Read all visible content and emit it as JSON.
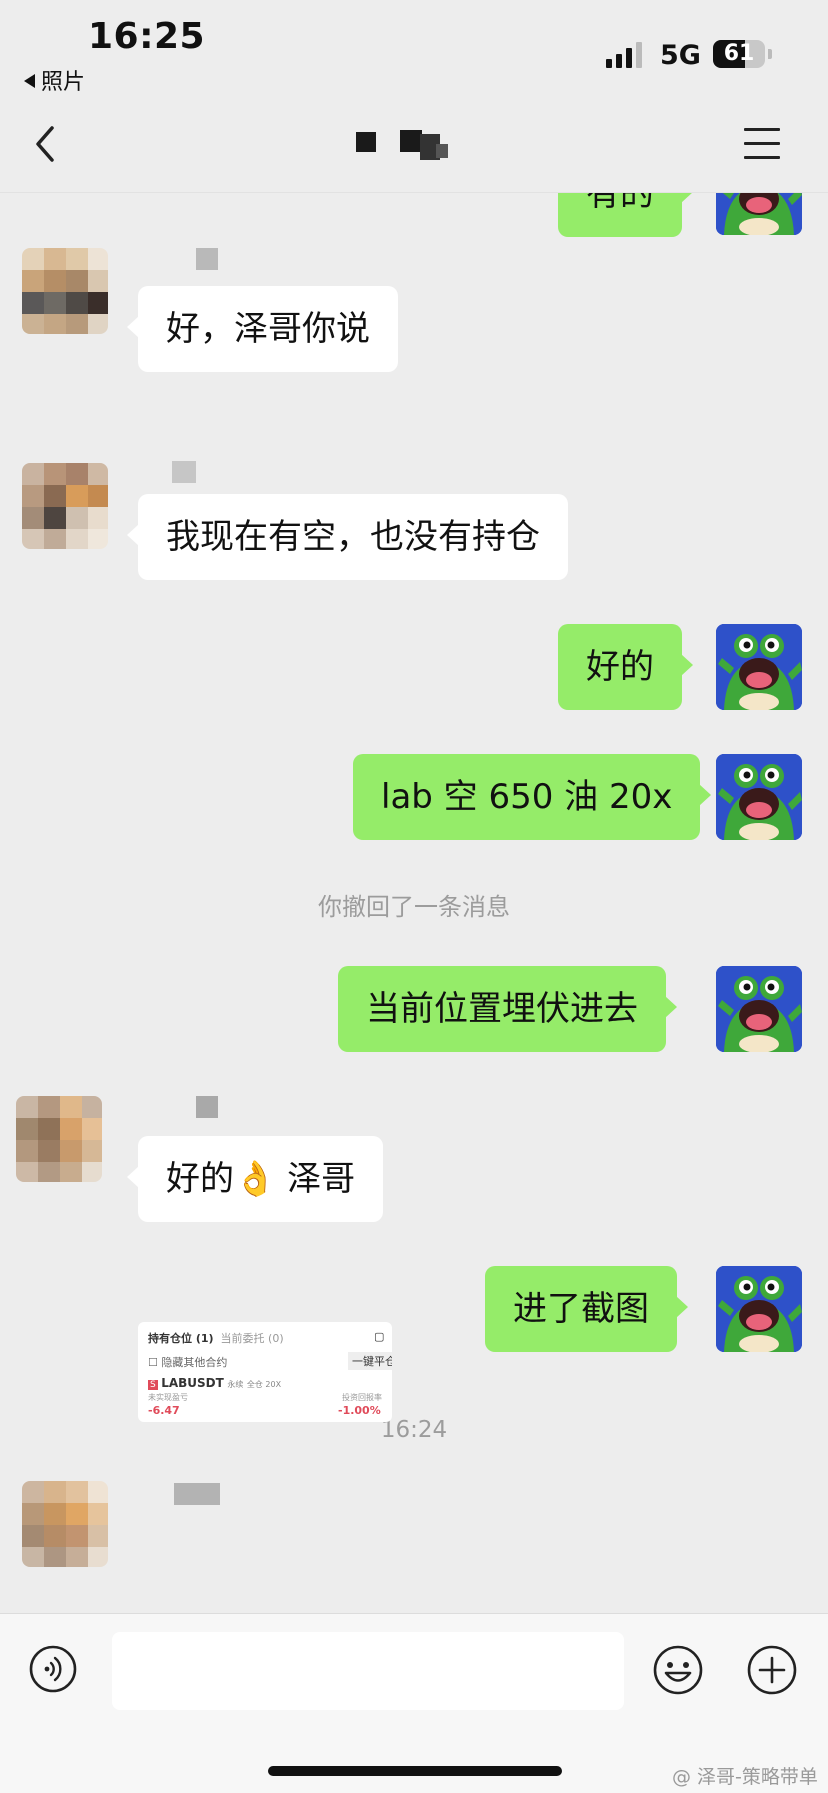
{
  "status_bar": {
    "time": "16:25",
    "back_app": "照片",
    "network": "5G",
    "battery_percent": "61"
  },
  "nav": {
    "icons": {
      "back": "chevron-left-icon",
      "menu": "hamburger-menu-icon"
    }
  },
  "messages": [
    {
      "side": "out",
      "text": "有的"
    },
    {
      "side": "in",
      "text": "好，泽哥你说"
    },
    {
      "side": "in",
      "text": "我现在有空，也没有持仓"
    },
    {
      "side": "out",
      "text": "好的"
    },
    {
      "side": "out",
      "text": "lab 空 650 油 20x"
    },
    {
      "side": "system",
      "text": "你撤回了一条消息"
    },
    {
      "side": "out",
      "text": "当前位置埋伏进去"
    },
    {
      "side": "in",
      "text": "好的👌 泽哥"
    },
    {
      "side": "out",
      "text": "进了截图"
    },
    {
      "side": "timestamp",
      "text": "16:24"
    }
  ],
  "screenshot_thumb": {
    "tab_positions": "持有仓位 (1)",
    "tab_orders": "当前委托 (0)",
    "hide_other": "隐藏其他合约",
    "close_all": "一键平仓",
    "symbol": "LABUSDT",
    "tag_perp": "永续",
    "tag_lev": "全仓 20X",
    "pnl_label": "未实现盈亏",
    "pnl_value": "-6.47",
    "roe_label": "投资回报率",
    "roe_value": "-1.00%"
  },
  "input_bar": {
    "text_value": "",
    "icons": {
      "voice": "voice-wave-icon",
      "emoji": "smiley-icon",
      "plus": "plus-circle-icon"
    }
  },
  "watermark": "@ 泽哥-策略带单",
  "colors": {
    "background": "#ededed",
    "bubble_out": "#95ec69",
    "bubble_in": "#ffffff",
    "frog_avatar_bg": "#2e51c9"
  }
}
